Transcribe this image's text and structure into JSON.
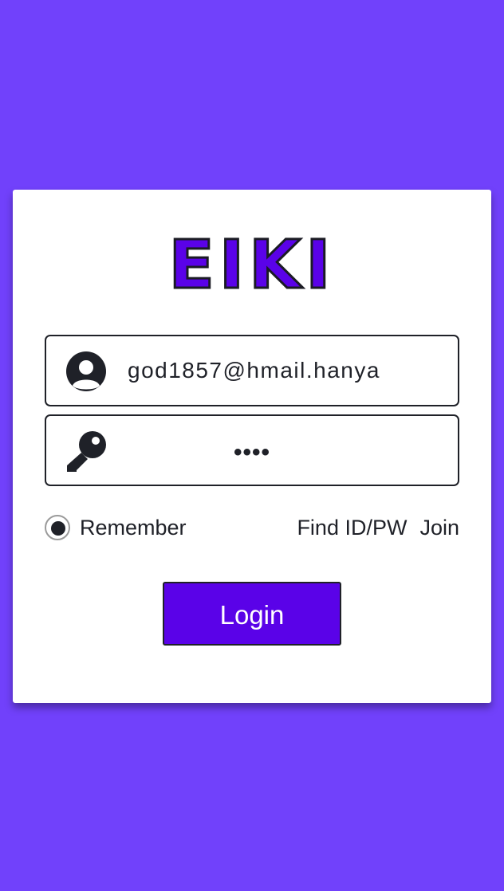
{
  "app": {
    "logo_text": "EIKI"
  },
  "form": {
    "username": {
      "value": "god1857@hmail.hanya",
      "icon": "user-circle-icon"
    },
    "password": {
      "masked_value": "••••",
      "icon": "key-icon"
    },
    "remember": {
      "label": "Remember",
      "checked": true
    },
    "find_label": "Find ID/PW",
    "join_label": "Join",
    "login_label": "Login"
  },
  "colors": {
    "background": "#7141fb",
    "accent": "#5a02e8",
    "card": "#ffffff",
    "text": "#1f2128"
  }
}
